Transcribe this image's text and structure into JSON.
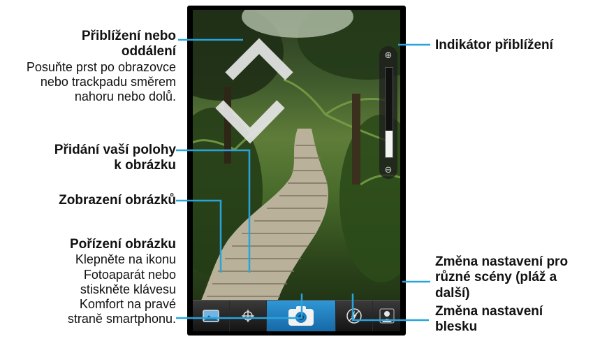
{
  "labels": {
    "zoom": {
      "title_line1": "Přiblížení nebo",
      "title_line2": "oddálení",
      "desc_line1": "Posuňte prst po obrazovce",
      "desc_line2": "nebo trackpadu směrem",
      "desc_line3": "nahoru nebo dolů."
    },
    "location": {
      "line1": "Přidání vaší polohy",
      "line2": "k obrázku"
    },
    "view_pictures": {
      "title": "Zobrazení obrázků"
    },
    "take_picture": {
      "title": "Pořízení obrázku",
      "desc_line1": "Klepněte na ikonu",
      "desc_line2": "Fotoaparát nebo",
      "desc_line3": "stiskněte klávesu",
      "desc_line4": "Komfort na pravé",
      "desc_line5": "straně smartphonu."
    },
    "zoom_indicator": {
      "title": "Indikátor přiblížení"
    },
    "scene": {
      "line1": "Změna nastavení pro",
      "line2": "různé scény (pláž a",
      "line3": "další)"
    },
    "flash": {
      "line1": "Změna nastavení",
      "line2": "blesku"
    }
  },
  "zoom_level": 0.3,
  "colors": {
    "leader": "#29a3dc",
    "capture_button": "#1f7fc2"
  },
  "toolbar": {
    "buttons": [
      {
        "icon": "picture-icon"
      },
      {
        "icon": "crosshair-icon"
      },
      {
        "icon": "camera-icon"
      },
      {
        "icon": "flash-icon"
      },
      {
        "icon": "scene-person-icon"
      }
    ]
  }
}
